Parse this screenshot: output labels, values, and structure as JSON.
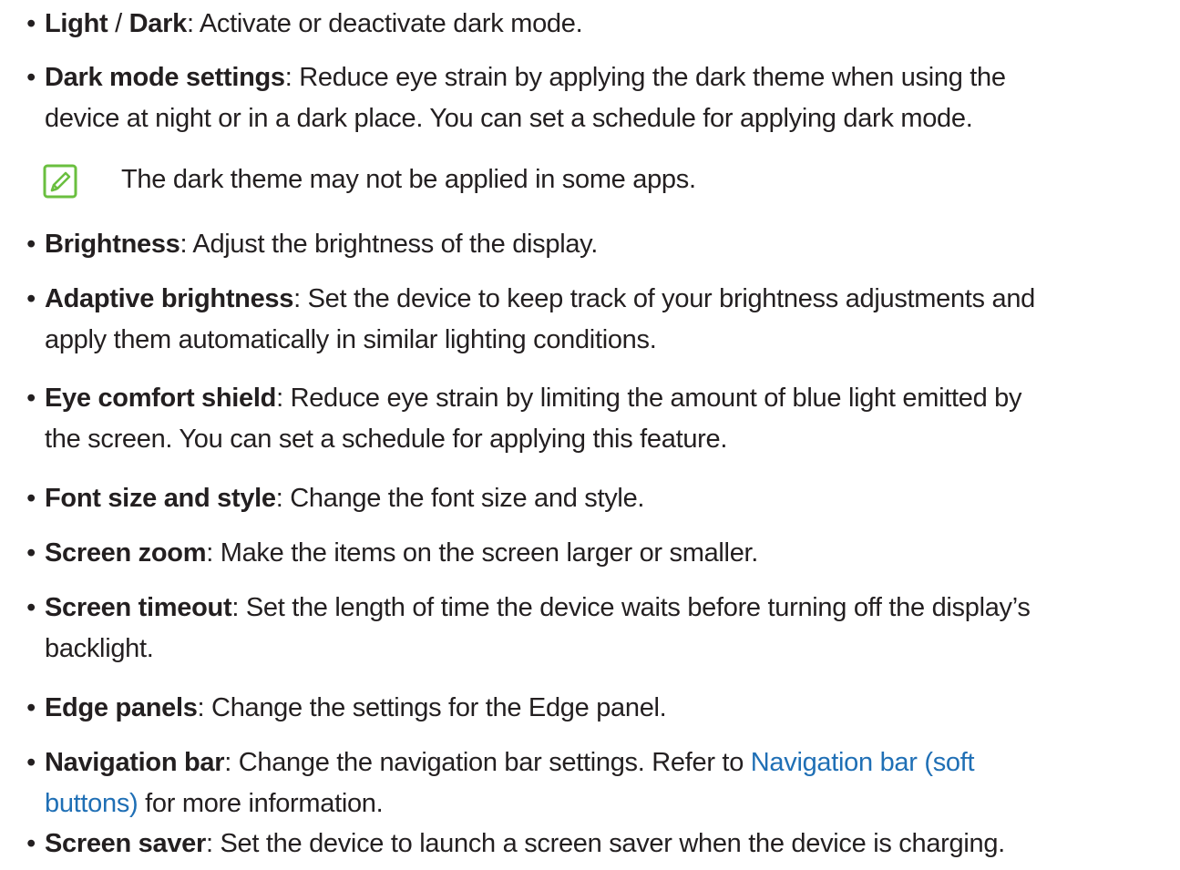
{
  "items": [
    {
      "term_a": "Light",
      "sep": " / ",
      "term_b": "Dark",
      "text": ": Activate or deactivate dark mode."
    },
    {
      "term": "Dark mode settings",
      "line1": ": Reduce eye strain by applying the dark theme when using the",
      "line2": "device at night or in a dark place. You can set a schedule for applying dark mode."
    },
    {
      "term": "Brightness",
      "text": ": Adjust the brightness of the display."
    },
    {
      "term": "Adaptive brightness",
      "line1": ": Set the device to keep track of your brightness adjustments and",
      "line2": "apply them automatically in similar lighting conditions."
    },
    {
      "term": "Eye comfort shield",
      "line1": ": Reduce eye strain by limiting the amount of blue light emitted by",
      "line2": "the screen. You can set a schedule for applying this feature."
    },
    {
      "term": "Font size and style",
      "text": ": Change the font size and style."
    },
    {
      "term": "Screen zoom",
      "text": ": Make the items on the screen larger or smaller."
    },
    {
      "term": "Screen timeout",
      "line1": ": Set the length of time the device waits before turning off the display’s",
      "line2": "backlight."
    },
    {
      "term": "Edge panels",
      "text": ": Change the settings for the Edge panel."
    },
    {
      "term": "Navigation bar",
      "line1_pre": ": Change the navigation bar settings. Refer to ",
      "link_part1": "Navigation bar (soft",
      "link_part2": "buttons)",
      "line2_post": " for more information."
    },
    {
      "term": "Screen saver",
      "text": ": Set the device to launch a screen saver when the device is charging."
    }
  ],
  "note": {
    "icon": "note-pencil-icon",
    "text": "The dark theme may not be applied in some apps.",
    "icon_color": "#6abf3f"
  },
  "bullet_char": "•",
  "colors": {
    "text": "#231f20",
    "link": "#1f6fb5"
  }
}
